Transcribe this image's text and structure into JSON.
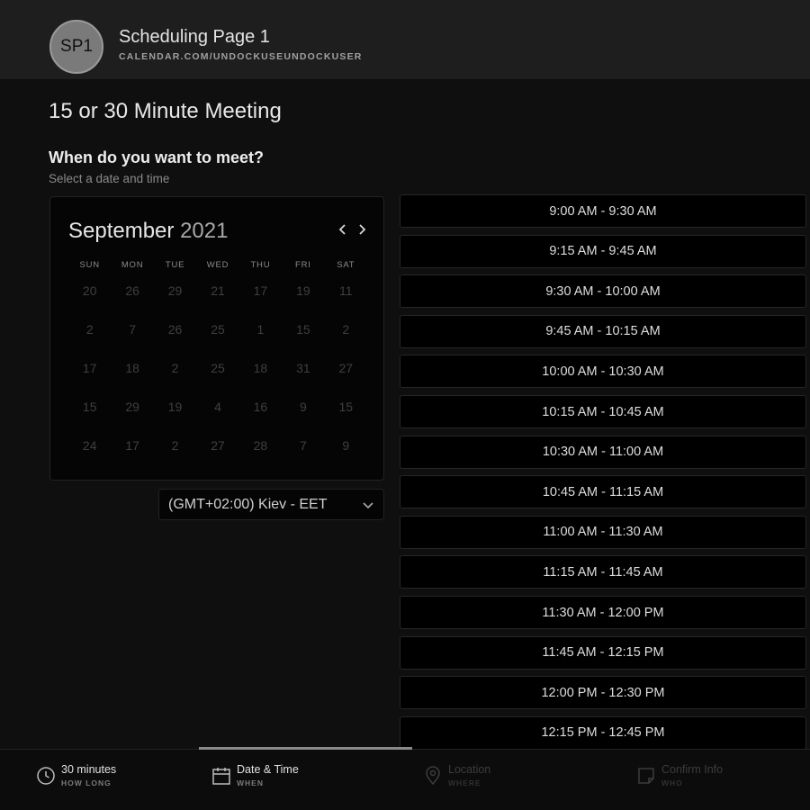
{
  "header": {
    "avatar_text": "SP1",
    "title": "Scheduling Page 1",
    "url": "CALENDAR.COM/UNDOCKUSEUNDOCKUSER"
  },
  "page_title": "15 or 30 Minute Meeting",
  "question": {
    "title": "When do you want to meet?",
    "subtitle": "Select a date and time"
  },
  "calendar": {
    "month": "September",
    "year": "2021",
    "days_of_week": [
      "SUN",
      "MON",
      "TUE",
      "WED",
      "THU",
      "FRI",
      "SAT"
    ],
    "weeks": [
      [
        "20",
        "26",
        "29",
        "21",
        "17",
        "19",
        "11"
      ],
      [
        "2",
        "7",
        "26",
        "25",
        "1",
        "15",
        "2"
      ],
      [
        "17",
        "18",
        "2",
        "25",
        "18",
        "31",
        "27"
      ],
      [
        "15",
        "29",
        "19",
        "4",
        "16",
        "9",
        "15"
      ],
      [
        "24",
        "17",
        "2",
        "27",
        "28",
        "7",
        "9"
      ]
    ]
  },
  "timezone": {
    "selected": "(GMT+02:00) Kiev - EET"
  },
  "time_slots": [
    "9:00 AM - 9:30 AM",
    "9:15 AM - 9:45 AM",
    "9:30 AM - 10:00 AM",
    "9:45 AM - 10:15 AM",
    "10:00 AM - 10:30 AM",
    "10:15 AM - 10:45 AM",
    "10:30 AM - 11:00 AM",
    "10:45 AM - 11:15 AM",
    "11:00 AM - 11:30 AM",
    "11:15 AM - 11:45 AM",
    "11:30 AM - 12:00 PM",
    "11:45 AM - 12:15 PM",
    "12:00 PM - 12:30 PM",
    "12:15 PM - 12:45 PM"
  ],
  "footer": {
    "steps": [
      {
        "label": "30 minutes",
        "sub": "HOW LONG",
        "icon": "clock-icon",
        "state": "active"
      },
      {
        "label": "Date & Time",
        "sub": "WHEN",
        "icon": "calendar-icon",
        "state": "active"
      },
      {
        "label": "Location",
        "sub": "WHERE",
        "icon": "location-pin-icon",
        "state": "dim"
      },
      {
        "label": "Confirm Info",
        "sub": "WHO",
        "icon": "note-icon",
        "state": "dim"
      }
    ]
  }
}
